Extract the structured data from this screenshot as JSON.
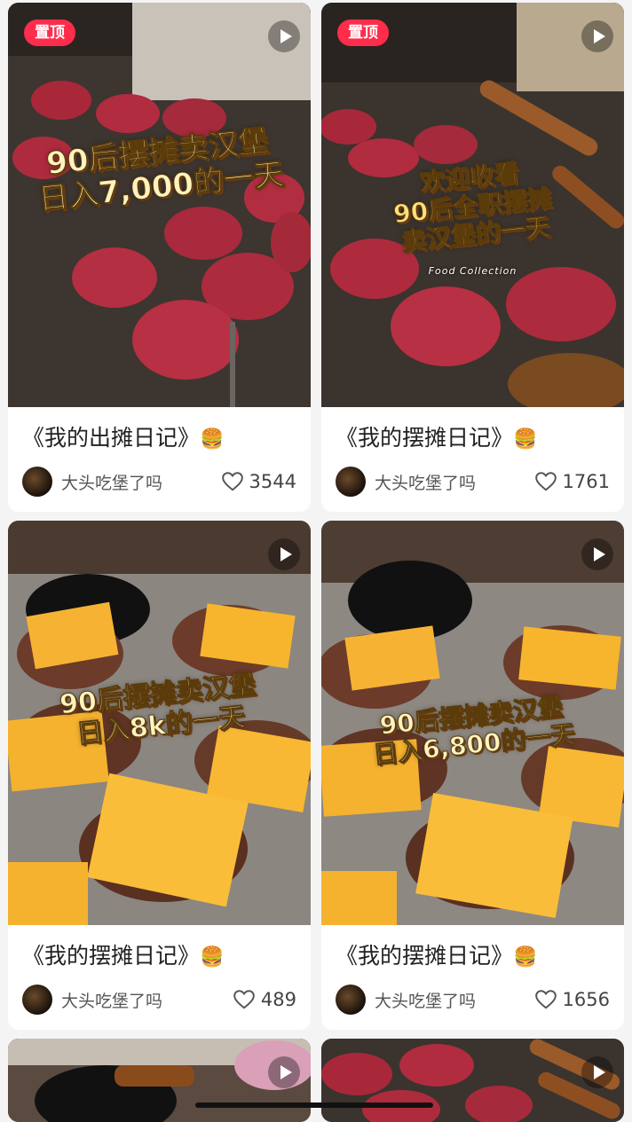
{
  "feed": {
    "cards": [
      {
        "pinned": true,
        "pin_label": "置顶",
        "overlay_lines": [
          "90后摆摊卖汉堡",
          "日入7,000的一天"
        ],
        "overlay_sub": "",
        "title": "《我的出摊日记》",
        "title_emoji": "🍔",
        "author": "大头吃堡了吗",
        "likes": "3544",
        "scene": "patties"
      },
      {
        "pinned": true,
        "pin_label": "置顶",
        "overlay_lines": [
          "欢迎收看",
          "90后全职摆摊",
          "卖汉堡的一天"
        ],
        "overlay_sub": "Food Collection",
        "title": "《我的摆摊日记》",
        "title_emoji": "🍔",
        "author": "大头吃堡了吗",
        "likes": "1761",
        "scene": "patties"
      },
      {
        "pinned": false,
        "pin_label": "",
        "overlay_lines": [
          "90后摆摊卖汉堡",
          "日入8k的一天"
        ],
        "overlay_sub": "",
        "title": "《我的摆摊日记》",
        "title_emoji": "🍔",
        "author": "大头吃堡了吗",
        "likes": "489",
        "scene": "cheese"
      },
      {
        "pinned": false,
        "pin_label": "",
        "overlay_lines": [
          "90后摆摊卖汉堡",
          "日入6,800的一天"
        ],
        "overlay_sub": "",
        "title": "《我的摆摊日记》",
        "title_emoji": "🍔",
        "author": "大头吃堡了吗",
        "likes": "1656",
        "scene": "cheese"
      }
    ]
  },
  "colors": {
    "pin_badge": "#ff2c4b",
    "background": "#f4f4f4"
  },
  "icons": {
    "play": "play-icon",
    "heart": "heart-outline-icon"
  }
}
